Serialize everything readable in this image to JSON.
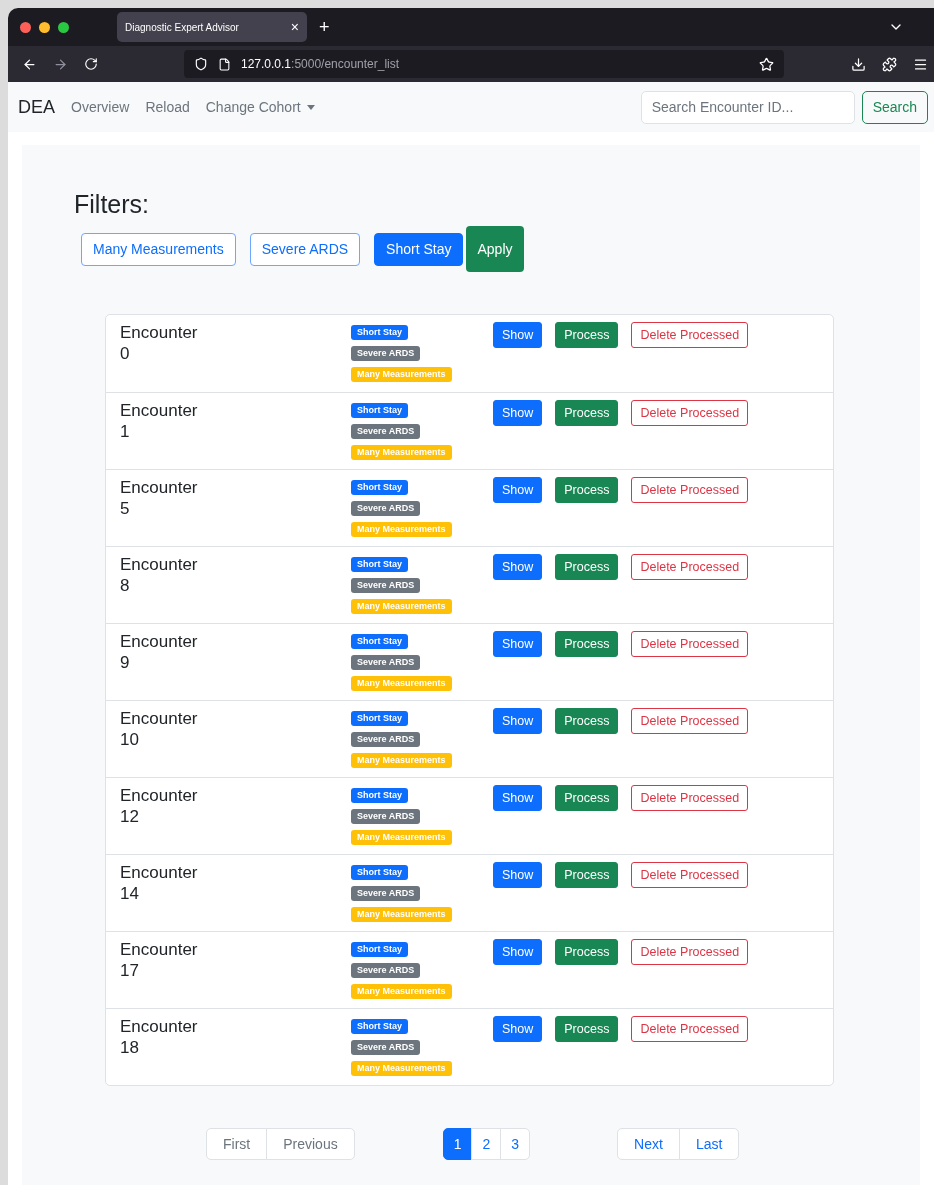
{
  "browser": {
    "tab_title": "Diagnostic Expert Advisor",
    "tab_close": "×",
    "new_tab": "+",
    "url_host": "127.0.0.1",
    "url_path": ":5000/encounter_list"
  },
  "navbar": {
    "brand": "DEA",
    "links": [
      {
        "label": "Overview",
        "kind": "link"
      },
      {
        "label": "Reload",
        "kind": "link"
      },
      {
        "label": "Change Cohort",
        "kind": "dropdown"
      }
    ],
    "search": {
      "placeholder": "Search Encounter ID...",
      "button": "Search"
    }
  },
  "filters": {
    "title": "Filters:",
    "options": [
      {
        "label": "Many Measurements",
        "selected": false
      },
      {
        "label": "Severe ARDS",
        "selected": false
      },
      {
        "label": "Short Stay",
        "selected": true
      }
    ],
    "apply": "Apply"
  },
  "encounters": [
    {
      "label": "Encounter",
      "id": "0",
      "badges": [
        {
          "text": "Short Stay",
          "color": "#0d6efd"
        },
        {
          "text": "Severe ARDS",
          "color": "#6c757d"
        },
        {
          "text": "Many Measurements",
          "color": "#ffc107"
        }
      ],
      "actions": [
        {
          "label": "Show",
          "kind": "primary"
        },
        {
          "label": "Process",
          "kind": "success"
        },
        {
          "label": "Delete Processed",
          "kind": "danger-outline"
        }
      ]
    },
    {
      "label": "Encounter",
      "id": "1",
      "badges": [
        {
          "text": "Short Stay",
          "color": "#0d6efd"
        },
        {
          "text": "Severe ARDS",
          "color": "#6c757d"
        },
        {
          "text": "Many Measurements",
          "color": "#ffc107"
        }
      ],
      "actions": [
        {
          "label": "Show",
          "kind": "primary"
        },
        {
          "label": "Process",
          "kind": "success"
        },
        {
          "label": "Delete Processed",
          "kind": "danger-outline"
        }
      ]
    },
    {
      "label": "Encounter",
      "id": "5",
      "badges": [
        {
          "text": "Short Stay",
          "color": "#0d6efd"
        },
        {
          "text": "Severe ARDS",
          "color": "#6c757d"
        },
        {
          "text": "Many Measurements",
          "color": "#ffc107"
        }
      ],
      "actions": [
        {
          "label": "Show",
          "kind": "primary"
        },
        {
          "label": "Process",
          "kind": "success"
        },
        {
          "label": "Delete Processed",
          "kind": "danger-outline"
        }
      ]
    },
    {
      "label": "Encounter",
      "id": "8",
      "badges": [
        {
          "text": "Short Stay",
          "color": "#0d6efd"
        },
        {
          "text": "Severe ARDS",
          "color": "#6c757d"
        },
        {
          "text": "Many Measurements",
          "color": "#ffc107"
        }
      ],
      "actions": [
        {
          "label": "Show",
          "kind": "primary"
        },
        {
          "label": "Process",
          "kind": "success"
        },
        {
          "label": "Delete Processed",
          "kind": "danger-outline"
        }
      ]
    },
    {
      "label": "Encounter",
      "id": "9",
      "badges": [
        {
          "text": "Short Stay",
          "color": "#0d6efd"
        },
        {
          "text": "Severe ARDS",
          "color": "#6c757d"
        },
        {
          "text": "Many Measurements",
          "color": "#ffc107"
        }
      ],
      "actions": [
        {
          "label": "Show",
          "kind": "primary"
        },
        {
          "label": "Process",
          "kind": "success"
        },
        {
          "label": "Delete Processed",
          "kind": "danger-outline"
        }
      ]
    },
    {
      "label": "Encounter",
      "id": "10",
      "badges": [
        {
          "text": "Short Stay",
          "color": "#0d6efd"
        },
        {
          "text": "Severe ARDS",
          "color": "#6c757d"
        },
        {
          "text": "Many Measurements",
          "color": "#ffc107"
        }
      ],
      "actions": [
        {
          "label": "Show",
          "kind": "primary"
        },
        {
          "label": "Process",
          "kind": "success"
        },
        {
          "label": "Delete Processed",
          "kind": "danger-outline"
        }
      ]
    },
    {
      "label": "Encounter",
      "id": "12",
      "badges": [
        {
          "text": "Short Stay",
          "color": "#0d6efd"
        },
        {
          "text": "Severe ARDS",
          "color": "#6c757d"
        },
        {
          "text": "Many Measurements",
          "color": "#ffc107"
        }
      ],
      "actions": [
        {
          "label": "Show",
          "kind": "primary"
        },
        {
          "label": "Process",
          "kind": "success"
        },
        {
          "label": "Delete Processed",
          "kind": "danger-outline"
        }
      ]
    },
    {
      "label": "Encounter",
      "id": "14",
      "badges": [
        {
          "text": "Short Stay",
          "color": "#0d6efd"
        },
        {
          "text": "Severe ARDS",
          "color": "#6c757d"
        },
        {
          "text": "Many Measurements",
          "color": "#ffc107"
        }
      ],
      "actions": [
        {
          "label": "Show",
          "kind": "primary"
        },
        {
          "label": "Process",
          "kind": "success"
        },
        {
          "label": "Delete Processed",
          "kind": "danger-outline"
        }
      ]
    },
    {
      "label": "Encounter",
      "id": "17",
      "badges": [
        {
          "text": "Short Stay",
          "color": "#0d6efd"
        },
        {
          "text": "Severe ARDS",
          "color": "#6c757d"
        },
        {
          "text": "Many Measurements",
          "color": "#ffc107"
        }
      ],
      "actions": [
        {
          "label": "Show",
          "kind": "primary"
        },
        {
          "label": "Process",
          "kind": "success"
        },
        {
          "label": "Delete Processed",
          "kind": "danger-outline"
        }
      ]
    },
    {
      "label": "Encounter",
      "id": "18",
      "badges": [
        {
          "text": "Short Stay",
          "color": "#0d6efd"
        },
        {
          "text": "Severe ARDS",
          "color": "#6c757d"
        },
        {
          "text": "Many Measurements",
          "color": "#ffc107"
        }
      ],
      "actions": [
        {
          "label": "Show",
          "kind": "primary"
        },
        {
          "label": "Process",
          "kind": "success"
        },
        {
          "label": "Delete Processed",
          "kind": "danger-outline"
        }
      ]
    }
  ],
  "pagination": {
    "back": [
      {
        "label": "First",
        "disabled": true
      },
      {
        "label": "Previous",
        "disabled": true
      }
    ],
    "pages": [
      {
        "label": "1",
        "selected": true
      },
      {
        "label": "2",
        "selected": false
      },
      {
        "label": "3",
        "selected": false
      }
    ],
    "forward": [
      {
        "label": "Next",
        "disabled": false
      },
      {
        "label": "Last",
        "disabled": false
      }
    ]
  }
}
